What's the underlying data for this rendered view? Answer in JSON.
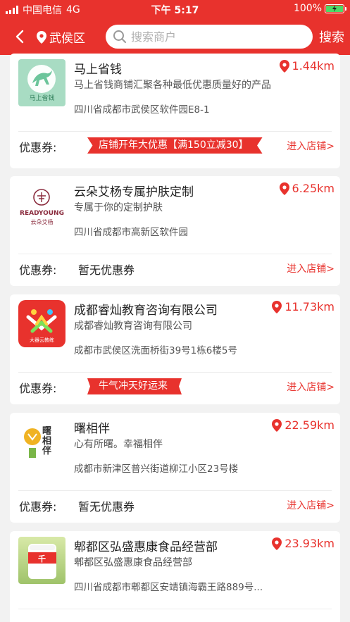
{
  "status_bar": {
    "carrier": "中国电信",
    "network": "4G",
    "time": "下午 5:17",
    "battery_percent": "100%",
    "battery_level": 1.0
  },
  "header": {
    "back_icon": "chevron-left-icon",
    "location": "武侯区",
    "search_placeholder": "搜索商户",
    "search_button": "搜索"
  },
  "colors": {
    "brand": "#e8322d",
    "background": "#f2f2f2"
  },
  "shop_common": {
    "coupon_label": "优惠券:",
    "enter_label": "进入店铺>"
  },
  "shops": [
    {
      "name": "马上省钱",
      "desc": "马上省钱商铺汇聚各种最低优惠质量好的产品，无论...",
      "address": "四川省成都市武侯区软件园E8-1",
      "distance": "1.44km",
      "coupon": "店铺开年大优惠【满150立减30】",
      "logo_text": "马上省钱"
    },
    {
      "name": "云朵艾杨专属护肤定制",
      "desc": "专属于你的定制护肤",
      "address": "四川省成都市高新区软件园",
      "distance": "6.25km",
      "no_coupon": "暂无优惠券",
      "logo_text": "READYOUNG",
      "logo_subtext": "云朵艾杨"
    },
    {
      "name": "成都睿灿教育咨询有限公司",
      "desc": "成都睿灿教育咨询有限公司",
      "address": "成都市武侯区洗面桥街39号1栋6楼5号",
      "distance": "11.73km",
      "coupon": "牛气冲天好运来",
      "logo_text": "大器云教练"
    },
    {
      "name": "曙相伴",
      "desc": "心有所曙。幸福相伴",
      "address": "成都市新津区普兴街道柳江小区23号楼",
      "distance": "22.59km",
      "no_coupon": "暂无优惠券",
      "logo_text": "曙相伴"
    },
    {
      "name": "郫都区弘盛惠康食品经营部",
      "desc": "郫都区弘盛惠康食品经营部",
      "address": "四川省成都市郫都区安靖镇海霸王路889号...",
      "distance": "23.93km",
      "logo_text": "千"
    }
  ]
}
